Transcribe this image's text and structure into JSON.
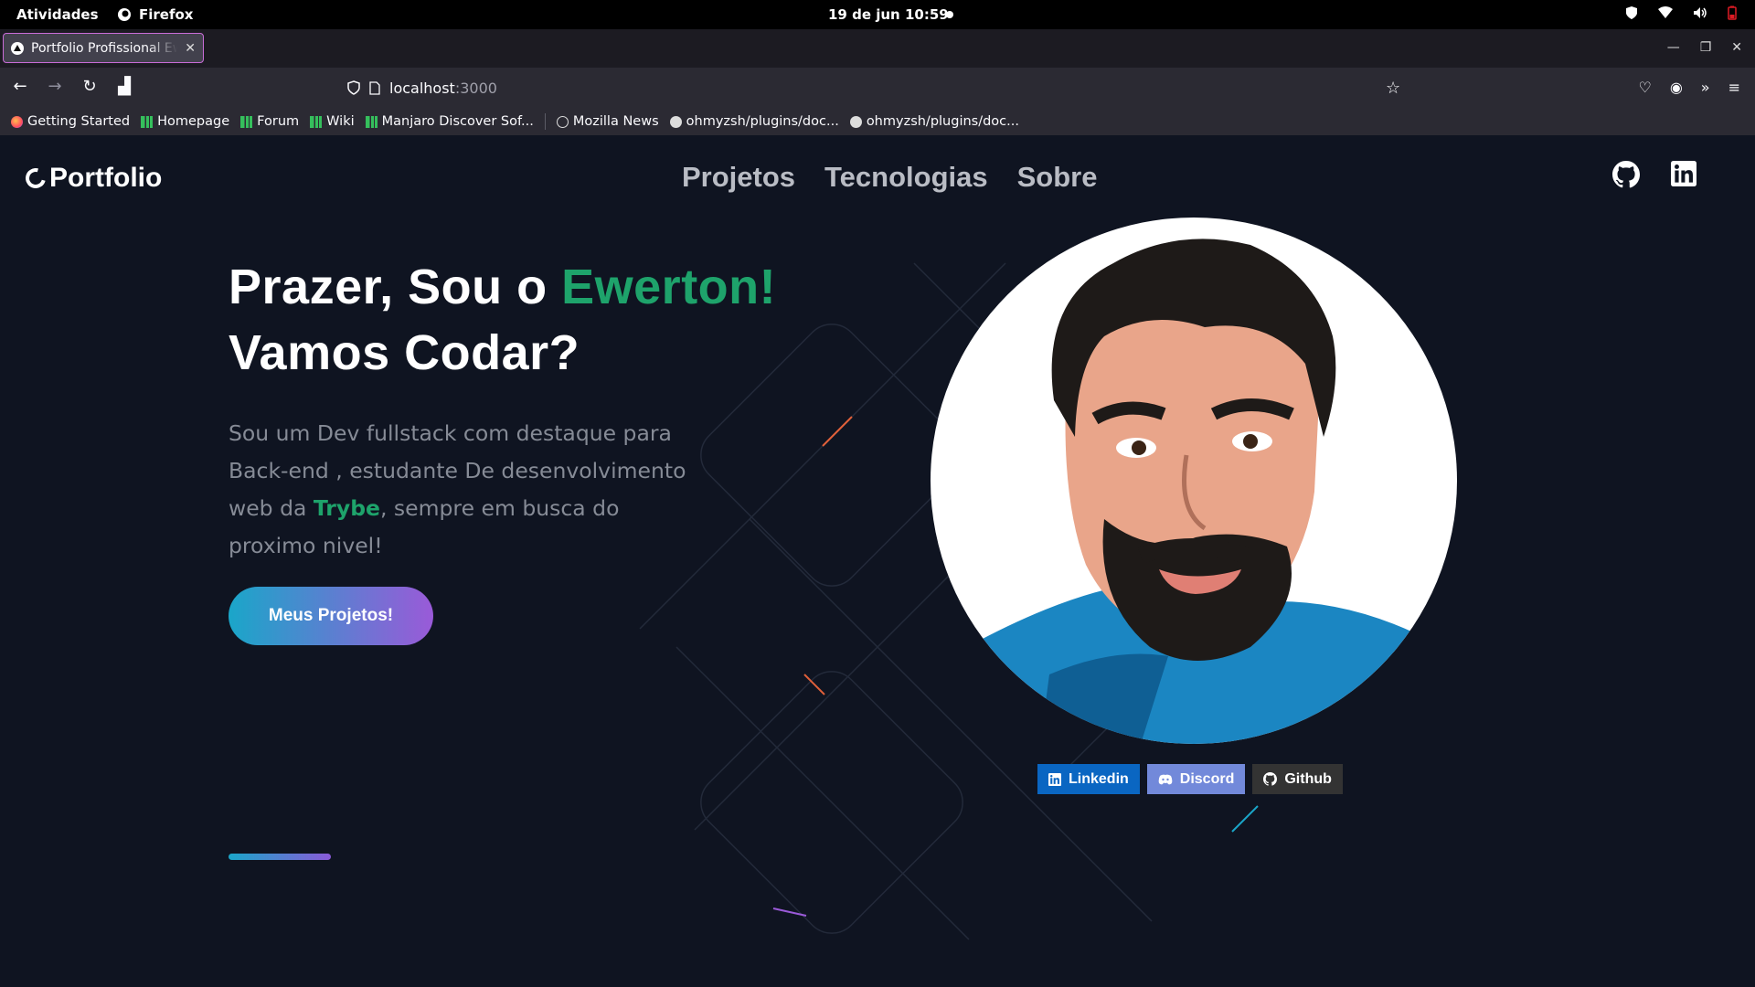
{
  "system": {
    "activities": "Atividades",
    "app_name": "Firefox",
    "clock": "19 de jun  10:59"
  },
  "browser": {
    "tab_title": "Portfolio Profissional Ewerton",
    "url_host": "localhost",
    "url_port": ":3000",
    "bookmarks": [
      {
        "label": "Getting Started",
        "icon": "firefox-icon"
      },
      {
        "label": "Homepage",
        "icon": "manjaro-icon"
      },
      {
        "label": "Forum",
        "icon": "manjaro-icon"
      },
      {
        "label": "Wiki",
        "icon": "manjaro-icon"
      },
      {
        "label": "Manjaro Discover Sof...",
        "icon": "manjaro-icon"
      },
      {
        "label": "Mozilla News",
        "icon": "globe-icon"
      },
      {
        "label": "ohmyzsh/plugins/doc...",
        "icon": "github-icon"
      },
      {
        "label": "ohmyzsh/plugins/doc...",
        "icon": "github-icon"
      }
    ]
  },
  "site": {
    "logo": "Portfolio",
    "menu": [
      "Projetos",
      "Tecnologias",
      "Sobre"
    ],
    "hero": {
      "line1_prefix": "Prazer, Sou o ",
      "line1_name": "Ewerton!",
      "line2": "Vamos Codar?",
      "desc_before": "Sou um Dev fullstack com destaque para Back-end , estudante De desenvolvimento web da ",
      "desc_highlight": "Trybe",
      "desc_after": ", sempre em busca do proximo nivel!",
      "cta": "Meus Projetos!"
    },
    "badges": [
      "Linkedin",
      "Discord",
      "Github"
    ],
    "colors": {
      "accent_green": "#1ea36b",
      "background": "#0f1421",
      "cta_gradient_start": "#1aa6c9",
      "cta_gradient_end": "#9a5ad8",
      "linkedin": "#0a66c2",
      "discord": "#7289da",
      "github": "#333333"
    }
  }
}
